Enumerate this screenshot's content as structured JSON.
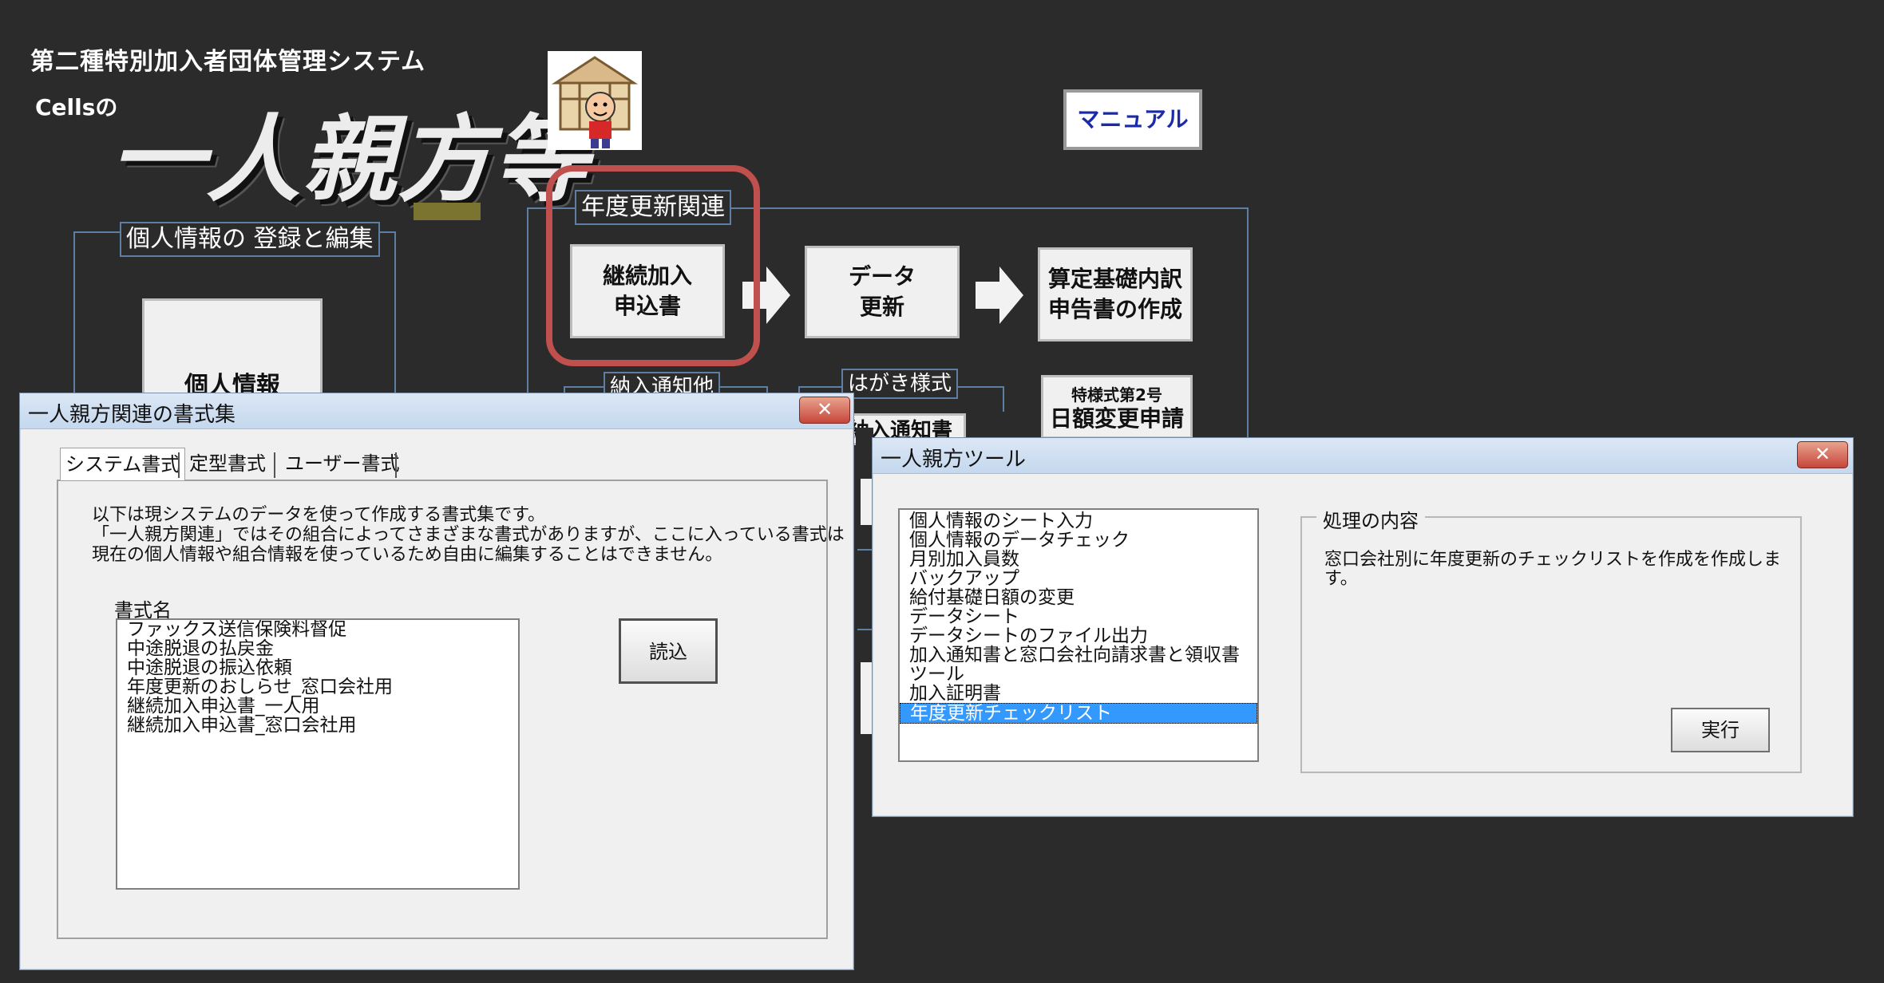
{
  "main": {
    "system_title": "第二種特別加入者団体管理システム",
    "cells_label": "Cellsの",
    "logo_text": "一人親方等",
    "manual_button": "マニュアル",
    "personal_panel": {
      "legend": "個人情報の 登録と編集",
      "button": "個人情報"
    },
    "renewal_panel": {
      "legend": "年度更新関連",
      "continue_button": "継続加入\n申込書",
      "data_update_button": "データ\n更新",
      "calc_button": "算定基礎内訳\n申告書の作成",
      "notice_legend": "納入通知他",
      "postcard_legend": "はがき様式",
      "postcard_button_partial": "納入通知書",
      "special_form_label": "特様式第2号",
      "daily_change_button": "日額変更申請"
    },
    "highlight_color": "#c0504d"
  },
  "forms_dialog": {
    "title": "一人親方関連の書式集",
    "close_label": "✕",
    "tabs": [
      "システム書式",
      "定型書式",
      "ユーザー書式"
    ],
    "description": [
      "以下は現システムのデータを使って作成する書式集です。",
      "「一人親方関連」ではその組合によってさまざまな書式がありますが、ここに入っている書式は",
      "現在の個人情報や組合情報を使っているため自由に編集することはできません。"
    ],
    "list_label": "書式名",
    "items": [
      "ファックス送信保険料督促",
      "中途脱退の払戻金",
      "中途脱退の振込依頼",
      "年度更新のおしらせ_窓口会社用",
      "継続加入申込書_一人用",
      "継続加入申込書_窓口会社用"
    ],
    "load_button": "読込"
  },
  "tools_dialog": {
    "title": "一人親方ツール",
    "close_label": "✕",
    "items": [
      "個人情報のシート入力",
      "個人情報のデータチェック",
      "月別加入員数",
      "バックアップ",
      "給付基礎日額の変更",
      "データシート",
      "データシートのファイル出力",
      "加入通知書と窓口会社向請求書と領収書",
      "ツール",
      "加入証明書",
      "年度更新チェックリスト"
    ],
    "selected_index": 10,
    "process_group_label": "処理の内容",
    "process_text": [
      "窓口会社別に年度更新のチェックリストを作成を作成しま",
      "す。"
    ],
    "run_button": "実行"
  }
}
